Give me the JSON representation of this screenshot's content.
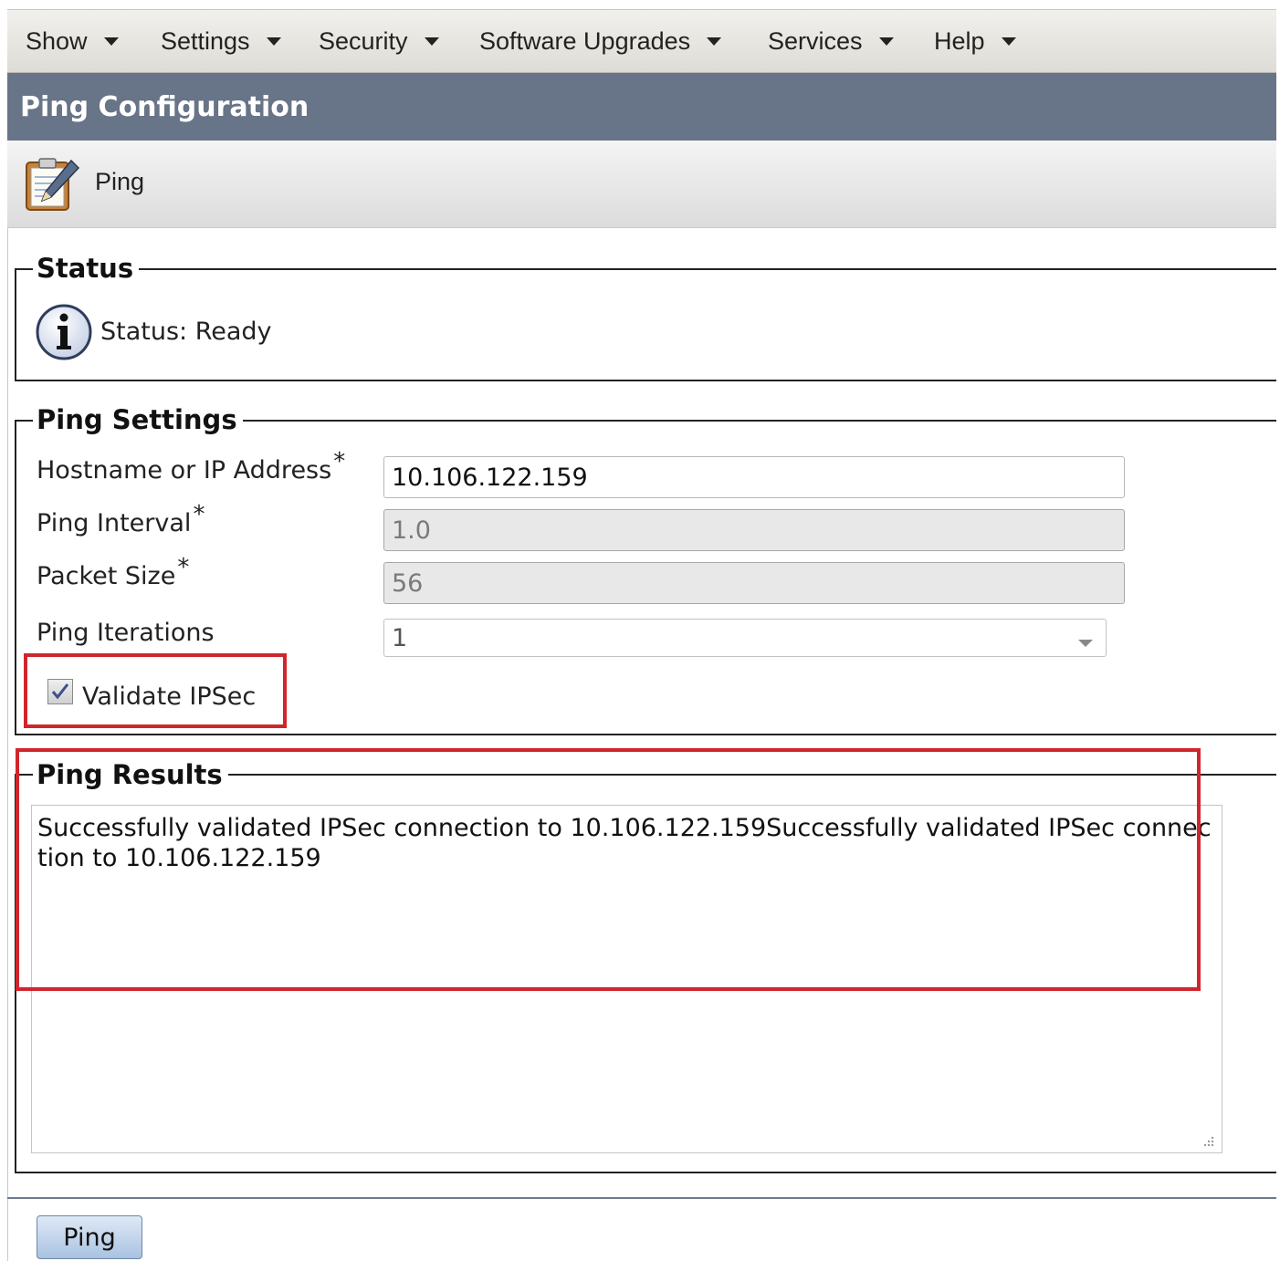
{
  "menu": {
    "items": [
      {
        "label": "Show"
      },
      {
        "label": "Settings"
      },
      {
        "label": "Security"
      },
      {
        "label": "Software Upgrades"
      },
      {
        "label": "Services"
      },
      {
        "label": "Help"
      }
    ]
  },
  "page": {
    "title": "Ping Configuration"
  },
  "toolbar": {
    "ping_label": "Ping",
    "icon": "clipboard-edit-icon"
  },
  "status": {
    "legend": "Status",
    "icon": "info-icon",
    "text": "Status: Ready"
  },
  "settings": {
    "legend": "Ping Settings",
    "hostname_label": "Hostname or IP Address",
    "hostname_value": "10.106.122.159",
    "interval_label": "Ping Interval",
    "interval_value": "1.0",
    "packet_label": "Packet Size",
    "packet_value": "56",
    "iterations_label": "Ping Iterations",
    "iterations_value": "1",
    "required_mark": "*",
    "validate_label": "Validate IPSec",
    "validate_checked": true
  },
  "results": {
    "legend": "Ping Results",
    "text": "Successfully validated IPSec connection to 10.106.122.159Successfully validated IPSec connection to 10.106.122.159"
  },
  "actions": {
    "ping_button": "Ping"
  },
  "colors": {
    "title_bar": "#687487",
    "highlight": "#d0252c",
    "button": "#b8cde8"
  }
}
